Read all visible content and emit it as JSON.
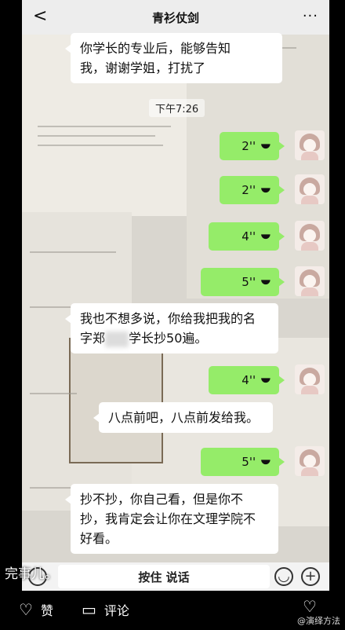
{
  "header": {
    "back_glyph": "<",
    "title": "青衫仗剑",
    "more_glyph": "···"
  },
  "messages": {
    "m1_line1": "你学长的专业后，能够告知",
    "m1_line2": "我，谢谢学姐，打扰了",
    "time": "下午7:26",
    "voice1": "2''",
    "voice2": "2''",
    "voice3": "4''",
    "voice4": "5''",
    "m2_line1": "我也不想多说，你给我把我的名",
    "m2_line2a": "字郑",
    "m2_line2b": "学长抄50遍。",
    "voice5": "4''",
    "m3": "八点前吧，八点前发给我。",
    "voice6": "5''",
    "m4_line1": "抄不抄，你自己看，但是你不",
    "m4_line2": "抄，我肯定会让你在文理学院不",
    "m4_line3": "好看。"
  },
  "input": {
    "hold_label": "按住 说话",
    "plus_glyph": "+"
  },
  "caption": "完事儿。",
  "actions": {
    "like_label": "赞",
    "comment_label": "评论",
    "fav_label": ""
  },
  "watermark": "@演绎方法",
  "colors": {
    "voice_bubble": "#95ec69",
    "bubble": "#ffffff",
    "bar": "#000000"
  }
}
